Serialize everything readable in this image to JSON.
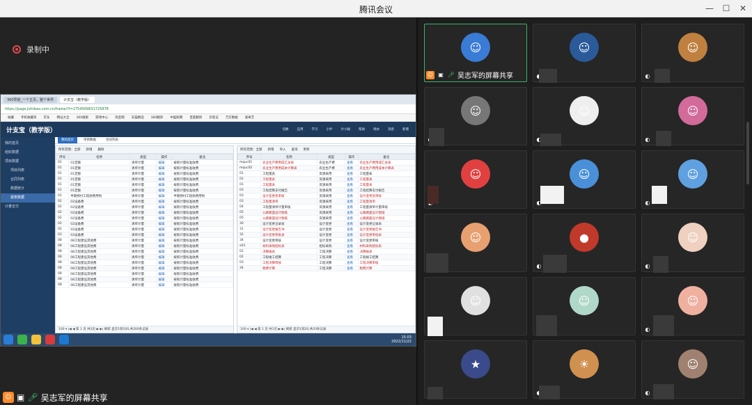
{
  "window": {
    "title": "腾讯会议",
    "controls": [
      "—",
      "☐",
      "✕"
    ]
  },
  "recording": {
    "label": "录制中"
  },
  "shared_screen": {
    "browser_tabs": [
      "360导航_一个主页，整个世界",
      "计支宝（教学版）"
    ],
    "url": "https://page.jizhibao.com.cn/frame/?t=2754569631725878",
    "favorites": [
      "收藏",
      "手机收藏夹",
      "京东",
      "网址大全",
      "360搜索",
      "游戏中心",
      "淘宝网",
      "天猫精选",
      "360翻译",
      "中国知网",
      "百度翻译",
      "云笔记",
      "万方数据",
      "爱奇艺"
    ],
    "app_title": "计支宝（教学版）",
    "app_menu": [
      "切换",
      "应用",
      "学习",
      "小叶",
      "计小秘",
      "帮助",
      "待办",
      "消息",
      "新增"
    ],
    "sidebar": [
      "我的首页",
      "组织数据",
      "项目数据",
      "项目列表",
      "合同列表",
      "数据统计",
      "报表数据",
      "计量支付"
    ],
    "subtabs": [
      "我的首页",
      "项目数据",
      "合同列表"
    ],
    "left_pane": {
      "toolbar": [
        "所有范围：全部",
        "新增",
        "删除"
      ],
      "headers": [
        "序号",
        "名称",
        "类型",
        "操作",
        "备注"
      ],
      "rows": [
        [
          "01",
          "01定额",
          "清单计量",
          "编辑",
          "按照计量标准收费"
        ],
        [
          "01",
          "01定额",
          "清单计量",
          "编辑",
          "按照计量标准收费"
        ],
        [
          "01",
          "01定额",
          "清单计量",
          "编辑",
          "按照计量标准收费"
        ],
        [
          "01",
          "01定额",
          "清单计量",
          "编辑",
          "按照计量标准收费"
        ],
        [
          "01",
          "01定额",
          "清单计量",
          "编辑",
          "按照计量标准收费"
        ],
        [
          "01",
          "01定额",
          "清单计量",
          "编辑",
          "按照计量标准收费"
        ],
        [
          "01",
          "半期预付工程款费用利",
          "清单计量",
          "编辑",
          "半期预付工程款费用利"
        ],
        [
          "02",
          "02设备费",
          "清单计量",
          "编辑",
          "按照计量标准收费"
        ],
        [
          "02",
          "02设备费",
          "清单计量",
          "编辑",
          "按照计量标准收费"
        ],
        [
          "02",
          "02设备费",
          "清单计量",
          "编辑",
          "按照计量标准收费"
        ],
        [
          "02",
          "02设备费",
          "清单计量",
          "编辑",
          "按照计量标准收费"
        ],
        [
          "02",
          "02设备费",
          "清单计量",
          "编辑",
          "按照计量标准收费"
        ],
        [
          "02",
          "02设备费",
          "清单计量",
          "编辑",
          "按照计量标准收费"
        ],
        [
          "03",
          "03设备费",
          "清单计量",
          "编辑",
          "按照计量标准收费"
        ],
        [
          "08",
          "08工程建设其他费",
          "清单计量",
          "编辑",
          "按照计量标准收费"
        ],
        [
          "08",
          "08工程建设其他费",
          "清单计量",
          "编辑",
          "按照计量标准收费"
        ],
        [
          "08",
          "08工程建设其他费",
          "清单计量",
          "编辑",
          "按照计量标准收费"
        ],
        [
          "08",
          "08工程建设其他费",
          "清单计量",
          "编辑",
          "按照计量标准收费"
        ],
        [
          "08",
          "08工程建设其他费",
          "清单计量",
          "编辑",
          "按照计量标准收费"
        ],
        [
          "08",
          "08工程建设其他费",
          "清单计量",
          "编辑",
          "按照计量标准收费"
        ],
        [
          "08",
          "08工程建设其他费",
          "清单计量",
          "编辑",
          "按照计量标准收费"
        ],
        [
          "08",
          "08工程建设其他费",
          "清单计量",
          "编辑",
          "按照计量标准收费"
        ],
        [
          "08",
          "08工程建设其他费",
          "清单计量",
          "编辑",
          "按照计量标准收费"
        ]
      ],
      "pager": "100 ▾  |◀ ◀  第 1 页 共3页  ▶ ▶|  刷新  显示1到100,共200条记录"
    },
    "right_pane": {
      "toolbar": [
        "所有范围：全部",
        "新增",
        "导入",
        "查询",
        "更新"
      ],
      "headers": [
        "序号",
        "名称",
        "类型",
        "操作",
        "备注"
      ],
      "rows": [
        [
          "mquc01",
          "农业生产费用成汇总表",
          "农业生产费",
          "查看",
          "农业生产费用成汇总表"
        ],
        [
          "mquc02",
          "农业生产费用成本计算表",
          "农业生产费",
          "查看",
          "农业生产费用成本计算表"
        ],
        [
          "01",
          "工程量表",
          "资源采用",
          "查看",
          "工程量表"
        ],
        [
          "01",
          "工程量表",
          "资源采用",
          "查看",
          "工程量表"
        ],
        [
          "01",
          "工程量表",
          "资源采用",
          "查看",
          "工程量表"
        ],
        [
          "03",
          "工程结算支付报告",
          "资源采用",
          "查看",
          "工程结算支付报告"
        ],
        [
          "03",
          "设计变更及审核",
          "资源采用",
          "查看",
          "设计变更及审核"
        ],
        [
          "03",
          "工程量清单",
          "资源采用",
          "查看",
          "工程量清单"
        ],
        [
          "04",
          "工程量清单计量审核",
          "资源采用",
          "查看",
          "工程量清单计量审核"
        ],
        [
          "05",
          "公路路面设计图纸",
          "资源采用",
          "查看",
          "公路路面设计图纸"
        ],
        [
          "05",
          "公路路面设计图纸",
          "资源采用",
          "查看",
          "公路路面设计图纸"
        ],
        [
          "30",
          "设计变更记录表",
          "设计变更",
          "查看",
          "设计变更记录表"
        ],
        [
          "31",
          "设计变更报告书",
          "设计变更",
          "查看",
          "设计变更报告书"
        ],
        [
          "32",
          "设计变更审批表",
          "设计变更",
          "查看",
          "设计变更审批表"
        ],
        [
          "34",
          "设计变更审核",
          "设计变更",
          "查看",
          "设计变更审核"
        ],
        [
          "s03",
          "材料采购招标表",
          "招标采购",
          "查看",
          "材料采购招标表"
        ],
        [
          "01",
          "决算报表",
          "工程决算",
          "查看",
          "决算报表"
        ],
        [
          "02",
          "工程竣工结算",
          "工程决算",
          "查看",
          "工程竣工结算"
        ],
        [
          "03",
          "工程决算审核",
          "工程决算",
          "查看",
          "工程决算审核"
        ],
        [
          "34",
          "税费计算",
          "工程决算",
          "查看",
          "税费计算"
        ]
      ],
      "pager": "100 ▾  |◀ ◀  第 1 页 共1页  ▶ ▶|  刷新  显示1到20,共20条记录"
    },
    "taskbar_clock": [
      "15:03",
      "2022/11/22"
    ]
  },
  "presenter_bar": {
    "label": "吴志军的屏幕共享"
  },
  "participants": [
    {
      "label": "吴志军的屏幕共享",
      "color": "#3a7bd5",
      "initial": "☺",
      "active": true
    },
    {
      "label": "",
      "color": "#2a5a9a",
      "initial": "☺",
      "active": false
    },
    {
      "label": "",
      "color": "#c08040",
      "initial": "☺",
      "active": false
    },
    {
      "label": "",
      "color": "#777777",
      "initial": "☺",
      "active": false
    },
    {
      "label": "",
      "color": "#eeeeee",
      "initial": "☺",
      "active": false
    },
    {
      "label": "",
      "color": "#d26a9a",
      "initial": "☺",
      "active": false
    },
    {
      "label": "",
      "color": "#e14040",
      "initial": "☺",
      "active": false
    },
    {
      "label": "",
      "color": "#4a90d9",
      "initial": "☺",
      "active": false
    },
    {
      "label": "",
      "color": "#5fa0e0",
      "initial": "☺",
      "active": false
    },
    {
      "label": "",
      "color": "#e8a070",
      "initial": "☺",
      "active": false
    },
    {
      "label": "",
      "color": "#c0392b",
      "initial": "●",
      "active": false
    },
    {
      "label": "",
      "color": "#f0d0c0",
      "initial": "☺",
      "active": false
    },
    {
      "label": "",
      "color": "#e0e0e0",
      "initial": "☺",
      "active": false
    },
    {
      "label": "",
      "color": "#b0d8c8",
      "initial": "☺",
      "active": false
    },
    {
      "label": "",
      "color": "#f0b0a0",
      "initial": "☺",
      "active": false
    },
    {
      "label": "",
      "color": "#3a4a8a",
      "initial": "★",
      "active": false
    },
    {
      "label": "",
      "color": "#d09050",
      "initial": "☀",
      "active": false
    },
    {
      "label": "",
      "color": "#a08070",
      "initial": "☺",
      "active": false
    }
  ]
}
